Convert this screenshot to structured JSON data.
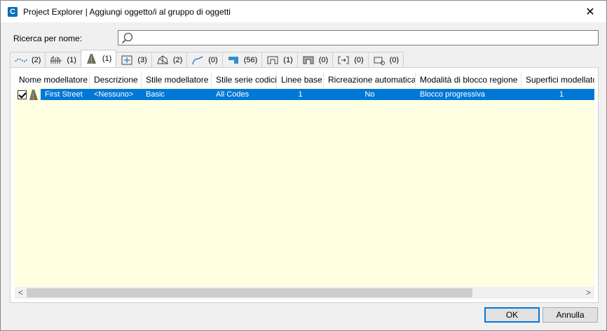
{
  "window": {
    "title": "Project Explorer | Aggiungi oggetto/i al gruppo di oggetti",
    "app_icon_letter": "C",
    "close_label": "✕"
  },
  "search": {
    "label": "Ricerca per nome:",
    "value": "",
    "placeholder": ""
  },
  "tabs": [
    {
      "icon": "alignment-icon",
      "count": "(2)"
    },
    {
      "icon": "bridge-icon",
      "count": "(1)"
    },
    {
      "icon": "corridor-icon",
      "count": "(1)",
      "active": true
    },
    {
      "icon": "assembly-icon",
      "count": "(3)"
    },
    {
      "icon": "surface-icon",
      "count": "(2)"
    },
    {
      "icon": "featureline-icon",
      "count": "(0)"
    },
    {
      "icon": "subassembly-icon",
      "count": "(56)"
    },
    {
      "icon": "pipe-structure-icon",
      "count": "(1)"
    },
    {
      "icon": "pressure-structure-icon",
      "count": "(0)"
    },
    {
      "icon": "sampleline-icon",
      "count": "(0)"
    },
    {
      "icon": "profile-view-icon",
      "count": "(0)"
    }
  ],
  "table": {
    "columns": [
      "Nome modellatore",
      "Descrizione",
      "Stile modellatore",
      "Stile serie codici",
      "Linee base",
      "Ricreazione automatica",
      "Modalità di blocco regione",
      "Superfici modellato"
    ],
    "rows": [
      {
        "checked": true,
        "icon": "corridor-icon",
        "cells": [
          "First Street",
          "<Nessuno>",
          "Basic",
          "All Codes",
          "1",
          "No",
          "Blocco progressiva",
          "1"
        ]
      }
    ]
  },
  "scrollbar": {
    "left_arrow": "<",
    "right_arrow": ">"
  },
  "buttons": {
    "ok": "OK",
    "cancel": "Annulla"
  },
  "colors": {
    "selection": "#0078d7",
    "grid_background": "#ffffe1",
    "accent": "#0a6cb5"
  }
}
